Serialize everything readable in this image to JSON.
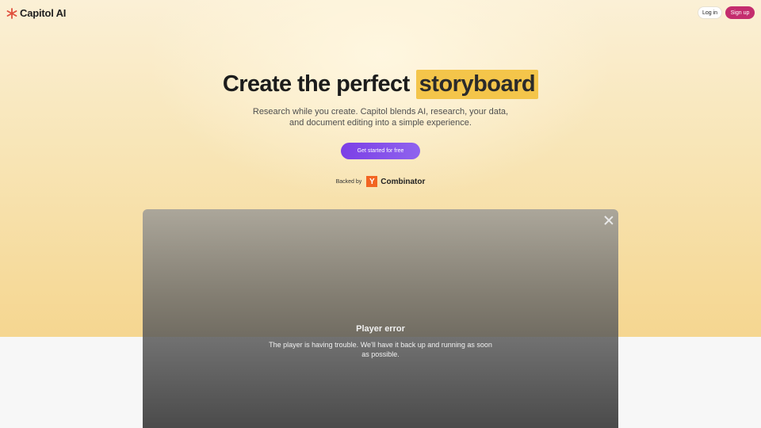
{
  "header": {
    "brand": "Capitol AI",
    "logo_icon": "asterisk-logo-icon",
    "login_label": "Log in",
    "signup_label": "Sign up"
  },
  "hero": {
    "headline": "Create the perfect",
    "highlight_word": "storyboard",
    "subtitle_line1": "Research while you create. Capitol blends AI, research, your data,",
    "subtitle_line2": "and document editing into a simple experience.",
    "cta_label": "Get started for free",
    "backed_label": "Backed by",
    "backer_badge": "Y",
    "backer_name": "Combinator"
  },
  "player": {
    "title": "Player error",
    "message": "The player is having trouble. We'll have it back up and running as soon as possible.",
    "close_icon": "close-icon"
  },
  "colors": {
    "signup": "#c42d6e",
    "highlight": "#f4c54a",
    "cta": "#7c3fe6",
    "yc": "#f26522"
  }
}
